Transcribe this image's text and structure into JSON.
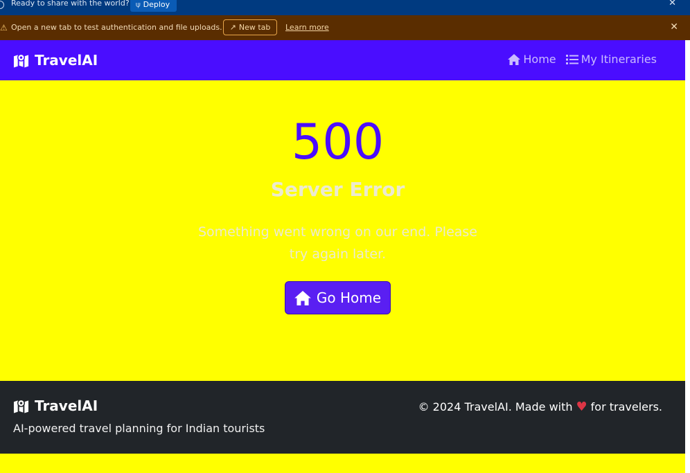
{
  "deploy_bar": {
    "message": "Ready to share with the world?",
    "deploy_label": "Deploy"
  },
  "warning_bar": {
    "message": "Open a new tab to test authentication and file uploads.",
    "new_tab_label": "New tab",
    "learn_more_label": "Learn more"
  },
  "navbar": {
    "brand": "TravelAI",
    "links": [
      {
        "label": "Home",
        "icon": "home-icon"
      },
      {
        "label": "My Itineraries",
        "icon": "list-icon"
      }
    ]
  },
  "error": {
    "code": "500",
    "title": "Server Error",
    "message": "Something went wrong on our end. Please try again later.",
    "button_label": "Go Home"
  },
  "footer": {
    "brand": "TravelAI",
    "tagline": "AI-powered travel planning for Indian tourists",
    "copyright_prefix": "© 2024 TravelAI. Made with",
    "copyright_suffix": "for travelers."
  },
  "colors": {
    "primary": "#4a0dff",
    "page_bg": "#ffff00",
    "footer_bg": "#212529",
    "heart": "#dc3545"
  }
}
